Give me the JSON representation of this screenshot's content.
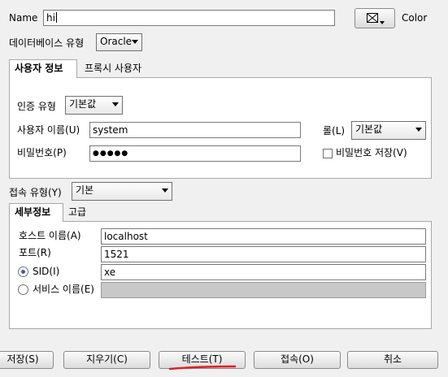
{
  "connection": {
    "name_label": "Name",
    "name_value": "hi",
    "color_label": "Color",
    "db_type_label": "데이터베이스 유형",
    "db_type_value": "Oracle"
  },
  "user_tabs": {
    "tabs": [
      {
        "label": "사용자 정보"
      },
      {
        "label": "프록시 사용자"
      }
    ]
  },
  "user_info": {
    "auth_type_label": "인증 유형",
    "auth_type_value": "기본값",
    "username_label": "사용자 이름(U)",
    "username_value": "system",
    "password_label": "비밀번호(P)",
    "password_value": "●●●●●",
    "role_label": "롤(L)",
    "role_value": "기본값",
    "save_password_label": "비밀번호 저장(V)"
  },
  "connect_type": {
    "label": "접속 유형(Y)",
    "value": "기본"
  },
  "detail_tabs": {
    "tabs": [
      {
        "label": "세부정보"
      },
      {
        "label": "고급"
      }
    ]
  },
  "details": {
    "host_label": "호스트 이름(A)",
    "host_value": "localhost",
    "port_label": "포트(R)",
    "port_value": "1521",
    "sid_label": "SID(I)",
    "sid_value": "xe",
    "service_label": "서비스 이름(E)",
    "service_value": ""
  },
  "buttons": {
    "save": "저장(S)",
    "clear": "지우기(C)",
    "test": "테스트(T)",
    "connect": "접속(O)",
    "cancel": "취소"
  },
  "colors": {
    "annotation_underline": "#e02020",
    "radio_selected": "#3a5fb0"
  }
}
